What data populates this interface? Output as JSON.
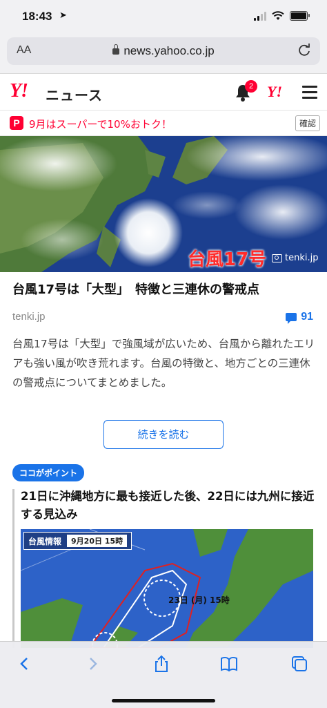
{
  "status": {
    "time": "18:43"
  },
  "browser": {
    "aa_label": "AA",
    "url": "news.yahoo.co.jp"
  },
  "header": {
    "logo": "Y!",
    "section": "ニュース",
    "notification_count": "2",
    "yahoo_icon": "Y!"
  },
  "promo": {
    "icon": "P",
    "text": "9月はスーパーで10%おトク！",
    "confirm_label": "確認"
  },
  "hero": {
    "caption": "台風17号",
    "credit": "tenki.jp"
  },
  "article": {
    "title": "台風17号は「大型」　特徴と三連休の警戒点",
    "source": "tenki.jp",
    "comment_count": "91",
    "summary": "台風17号は「大型」で強風域が広いため、台風から離れたエリアも強い風が吹き荒れます。台風の特徴と、地方ごとの三連休の警戒点についてまとめました。",
    "read_more": "続きを読む"
  },
  "point": {
    "badge": "ココがポイント",
    "text": "21日に沖縄地方に最も接近した後、22日には九州に接近する見込み"
  },
  "map": {
    "label": "台風情報",
    "date": "9月20日 15時",
    "position_label": "23日 (月) 15時"
  },
  "colors": {
    "yahoo_red": "#ff0033",
    "link_blue": "#1a73e8"
  }
}
